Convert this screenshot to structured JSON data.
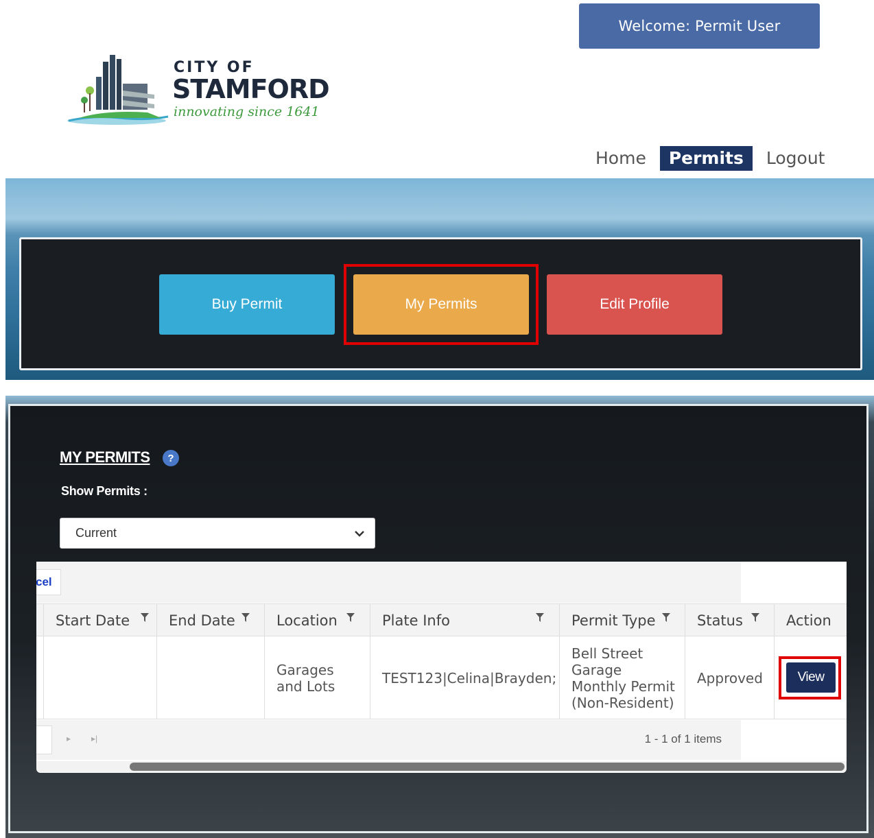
{
  "header": {
    "welcome": "Welcome:  Permit User",
    "logo": {
      "line1": "CITY OF",
      "line2": "STAMFORD",
      "tagline": "innovating since 1641"
    }
  },
  "nav": {
    "items": [
      {
        "label": "Home"
      },
      {
        "label": "Permits"
      },
      {
        "label": "Logout"
      }
    ],
    "active": "Permits"
  },
  "hero": {
    "buttons": [
      {
        "label": "Buy Permit",
        "color": "#36abd6"
      },
      {
        "label": "My Permits",
        "color": "#eaa94b"
      },
      {
        "label": "Edit Profile",
        "color": "#d9534f"
      }
    ]
  },
  "permits": {
    "title": "MY PERMITS",
    "help_icon": "question-circle-icon",
    "show_label": "Show Permits :",
    "filter_value": "Current",
    "toolbar_link": "cel",
    "columns": [
      "Start Date",
      "End Date",
      "Location",
      "Plate Info",
      "Permit Type",
      "Status",
      "Action"
    ],
    "rows": [
      {
        "start_date": "",
        "end_date": "",
        "location": "Garages and Lots",
        "plate_info": "TEST123|Celina|Brayden;",
        "permit_type": "Bell Street Garage Monthly Permit (Non-Resident)",
        "status": "Approved",
        "action": "View"
      }
    ],
    "pager_info": "1 - 1 of 1 items"
  }
}
